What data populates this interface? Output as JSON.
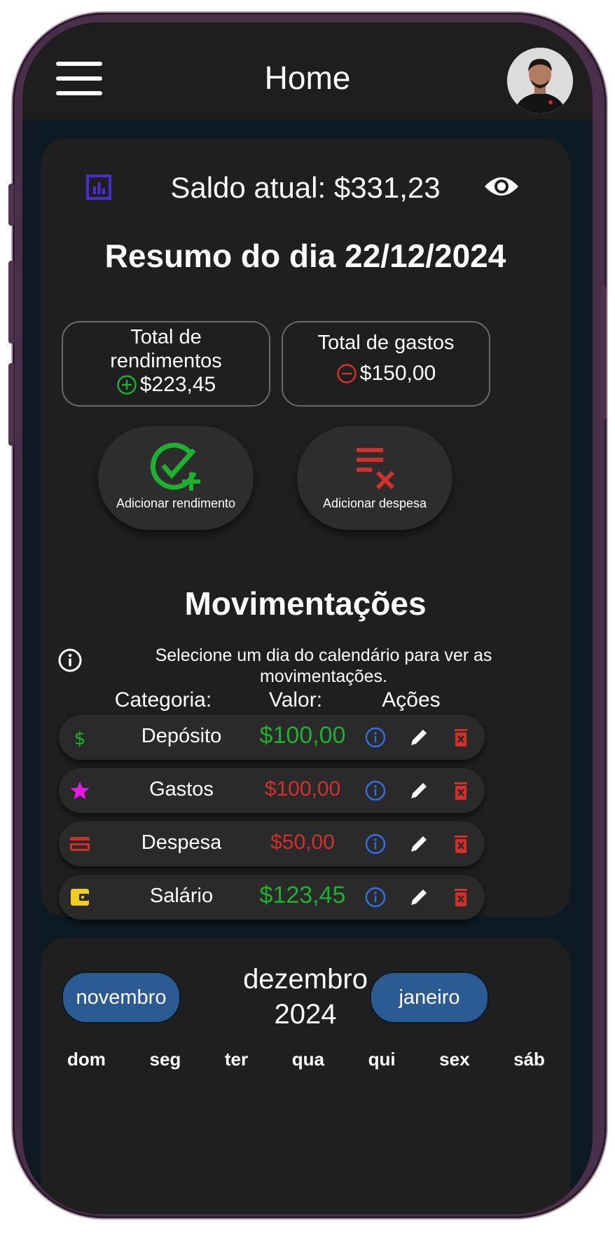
{
  "header": {
    "title": "Home",
    "menu_icon": "hamburger-icon",
    "avatar_icon": "user-avatar"
  },
  "balance": {
    "label": "Saldo atual: $331,23",
    "chart_icon": "bar-chart-icon",
    "visibility_icon": "eye-icon"
  },
  "summary": {
    "title": "Resumo do dia 22/12/2024",
    "income": {
      "label": "Total de rendimentos",
      "value": "$223,45",
      "icon": "plus-circle-icon"
    },
    "expenses": {
      "label": "Total de gastos",
      "value": "$150,00",
      "icon": "minus-circle-icon"
    }
  },
  "actions": [
    {
      "label": "Adicionar rendimento",
      "icon": "check-plus-icon"
    },
    {
      "label": "Adicionar despesa",
      "icon": "list-remove-icon"
    }
  ],
  "movements": {
    "title": "Movimentações",
    "info": "Selecione um dia do calendário para ver as movimentações.",
    "columns": [
      "Categoria:",
      "Valor:",
      "Ações"
    ],
    "rows": [
      {
        "category": "Depósito",
        "amount": "$100,00",
        "type": "income",
        "icon": "dollar-icon"
      },
      {
        "category": "Gastos",
        "amount": "$100,00",
        "type": "expense",
        "icon": "star-icon"
      },
      {
        "category": "Despesa",
        "amount": "$50,00",
        "type": "expense",
        "icon": "credit-card-icon"
      },
      {
        "category": "Salário",
        "amount": "$123,45",
        "type": "income",
        "icon": "wallet-icon"
      }
    ]
  },
  "calendar": {
    "prev": "novembro",
    "month": "dezembro",
    "year": "2024",
    "next": "janeiro",
    "weekdays": [
      "dom",
      "seg",
      "ter",
      "qua",
      "qui",
      "sex",
      "sáb"
    ]
  },
  "colors": {
    "background": "#1f1f1f",
    "income_green": "#1fb02f",
    "expense_red": "#d2312b",
    "info_blue": "#2f6fe0",
    "button_blue": "#2c5b93",
    "accent_purple": "#4b2bd4"
  }
}
